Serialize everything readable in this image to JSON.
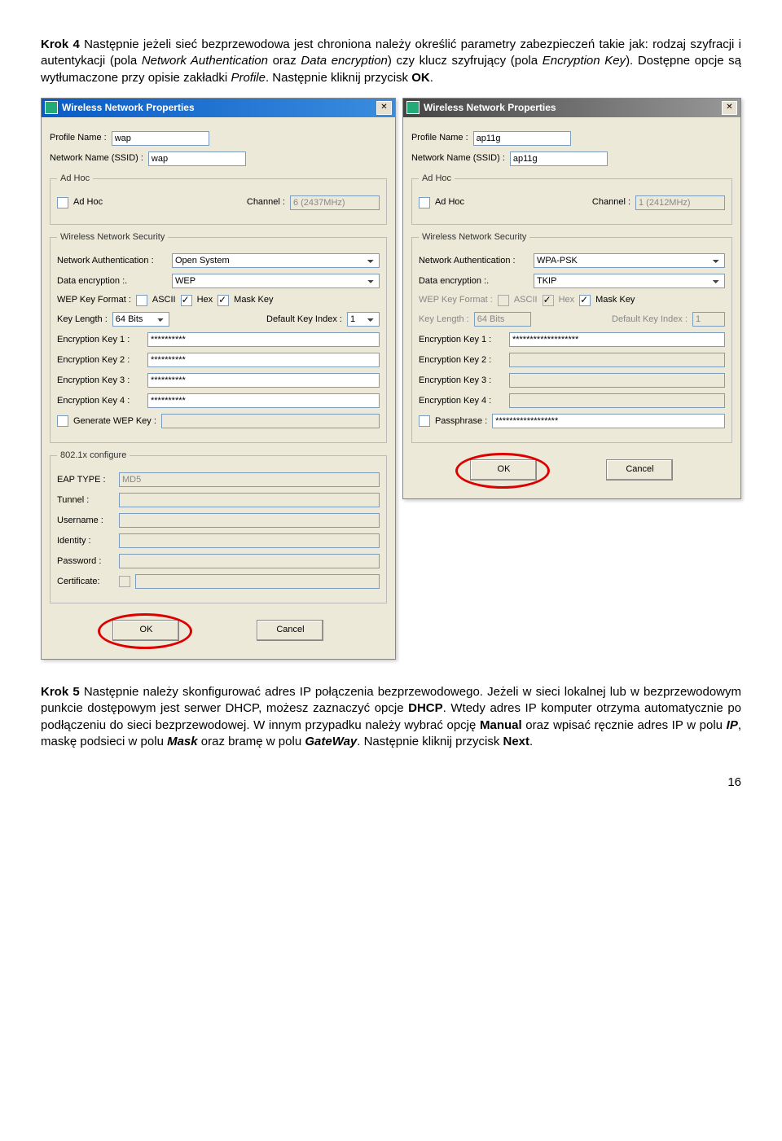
{
  "para1": {
    "lead": "Krok 4",
    "t1": " Następnie jeżeli sieć bezprzewodowa jest chroniona należy określić parametry zabezpieczeń takie jak: rodzaj szyfracji i autentykacji (pola ",
    "e1": "Network Authentication",
    "t2": " oraz ",
    "e2": "Data encryption",
    "t3": ") czy klucz szyfrujący (pola ",
    "e3": "Encryption Key",
    "t4": "). Dostępne opcje są wytłumaczone przy opisie zakładki ",
    "e4": "Profile",
    "t5": ". Następnie kliknij przycisk ",
    "s1": "OK",
    "t6": "."
  },
  "d1": {
    "title": "Wireless Network Properties",
    "pn_lbl": "Profile Name :",
    "pn_val": "wap",
    "nn_lbl": "Network Name (SSID) :",
    "nn_val": "wap",
    "adhoc_leg": "Ad Hoc",
    "adhoc_lbl": "Ad Hoc",
    "ch_lbl": "Channel :",
    "ch_val": "6 (2437MHz)",
    "sec_leg": "Wireless Network Security",
    "na_lbl": "Network Authentication :",
    "na_val": "Open System",
    "de_lbl": "Data encryption :.",
    "de_val": "WEP",
    "wkf_lbl": "WEP Key Format :",
    "ascii": "ASCII",
    "hex": "Hex",
    "mask": "Mask Key",
    "kl_lbl": "Key Length :",
    "kl_val": "64 Bits",
    "dki_lbl": "Default Key Index :",
    "dki_val": "1",
    "ek1": "Encryption Key 1 :",
    "ek2": "Encryption Key 2 :",
    "ek3": "Encryption Key 3 :",
    "ek4": "Encryption Key 4 :",
    "ekv": "**********",
    "gen": "Generate WEP Key :",
    "eap_leg": "802.1x configure",
    "eap_lbl": "EAP TYPE :",
    "eap_val": "MD5",
    "tun": "Tunnel :",
    "usr": "Username :",
    "idn": "Identity :",
    "pwd": "Password :",
    "crt": "Certificate:",
    "ok": "OK",
    "cancel": "Cancel"
  },
  "d2": {
    "title": "Wireless Network Properties",
    "pn_lbl": "Profile Name :",
    "pn_val": "ap11g",
    "nn_lbl": "Network Name (SSID) :",
    "nn_val": "ap11g",
    "adhoc_leg": "Ad Hoc",
    "adhoc_lbl": "Ad Hoc",
    "ch_lbl": "Channel :",
    "ch_val": "1 (2412MHz)",
    "sec_leg": "Wireless Network Security",
    "na_lbl": "Network Authentication :",
    "na_val": "WPA-PSK",
    "de_lbl": "Data encryption :.",
    "de_val": "TKIP",
    "wkf_lbl": "WEP Key Format :",
    "ascii": "ASCII",
    "hex": "Hex",
    "mask": "Mask Key",
    "kl_lbl": "Key Length :",
    "kl_val": "64 Bits",
    "dki_lbl": "Default Key Index :",
    "dki_val": "1",
    "ek1": "Encryption Key 1 :",
    "ek2": "Encryption Key 2 :",
    "ek3": "Encryption Key 3 :",
    "ek4": "Encryption Key 4 :",
    "ek1v": "*******************",
    "pph": "Passphrase :",
    "pphv": "******************",
    "ok": "OK",
    "cancel": "Cancel"
  },
  "para2": {
    "lead": "Krok 5",
    "t1": " Następnie należy skonfigurować adres IP połączenia bezprzewodowego. Jeżeli w sieci lokalnej lub w bezprzewodowym punkcie dostępowym jest serwer DHCP, możesz zaznaczyć opcje ",
    "s1": "DHCP",
    "t2": ". Wtedy adres IP komputer otrzyma automatycznie po podłączeniu do sieci bezprzewodowej. W innym przypadku należy wybrać opcję ",
    "s2": "Manual",
    "t3": " oraz wpisać ręcznie adres IP w polu ",
    "e1": "IP",
    "t4": ", maskę podsieci w polu ",
    "e2": "Mask",
    "t5": " oraz bramę w polu ",
    "e3": "GateWay",
    "t6": ". Następnie kliknij przycisk ",
    "s3": "Next",
    "t7": "."
  },
  "page": "16"
}
